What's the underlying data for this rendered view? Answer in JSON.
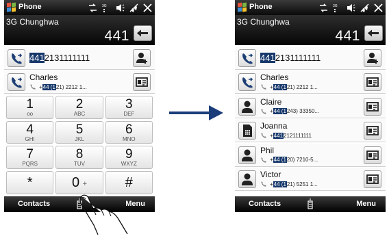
{
  "colors": {
    "accent_navy": "#17386b",
    "bar_dark": "#111111",
    "arrow_blue": "#1b3d7a"
  },
  "status_icons": [
    "network-icon",
    "3g-signal-icon",
    "speaker-icon",
    "signal-strength-icon",
    "close-icon"
  ],
  "left": {
    "title": "Phone",
    "carrier": "3G Chunghwa",
    "dialed": "441",
    "match_number": {
      "highlight": "441",
      "rest": "2131111111"
    },
    "contact": {
      "name": "Charles",
      "prefix": "+",
      "highlight": "44 (1",
      "rest": "21) 2212 1..."
    },
    "keys": [
      {
        "digit": "1",
        "letters": "oo"
      },
      {
        "digit": "2",
        "letters": "ABC"
      },
      {
        "digit": "3",
        "letters": "DEF"
      },
      {
        "digit": "4",
        "letters": "GHI"
      },
      {
        "digit": "5",
        "letters": "JKL"
      },
      {
        "digit": "6",
        "letters": "MNO"
      },
      {
        "digit": "7",
        "letters": "PQRS"
      },
      {
        "digit": "8",
        "letters": "TUV"
      },
      {
        "digit": "9",
        "letters": "WXYZ"
      }
    ],
    "key_star": "*",
    "key_zero": "0",
    "key_zero_plus": "+",
    "key_hash": "#",
    "soft_left": "Contacts",
    "soft_right": "Menu"
  },
  "right": {
    "title": "Phone",
    "carrier": "3G Chunghwa",
    "dialed": "441",
    "match_number": {
      "highlight": "441",
      "rest": "2131111111"
    },
    "contacts": [
      {
        "name": "Charles",
        "prefix": "+",
        "highlight": "44 (1",
        "rest": "21) 2212 1...",
        "icon": "phone-call-icon"
      },
      {
        "name": "Claire",
        "prefix": "+",
        "highlight": "44 (1",
        "rest": "243) 33350...",
        "icon": "person-icon"
      },
      {
        "name": "Joanna",
        "prefix": "+",
        "highlight": "441",
        "rest": "2121111111",
        "icon": "sim-card-icon"
      },
      {
        "name": "Phil",
        "prefix": "+",
        "highlight": "44 (1",
        "rest": "20) 7210-5...",
        "icon": "person-icon"
      },
      {
        "name": "Victor",
        "prefix": "+",
        "highlight": "44 (1",
        "rest": "21) 5251 1...",
        "icon": "person-icon"
      }
    ],
    "soft_left": "Contacts",
    "soft_right": "Menu"
  }
}
